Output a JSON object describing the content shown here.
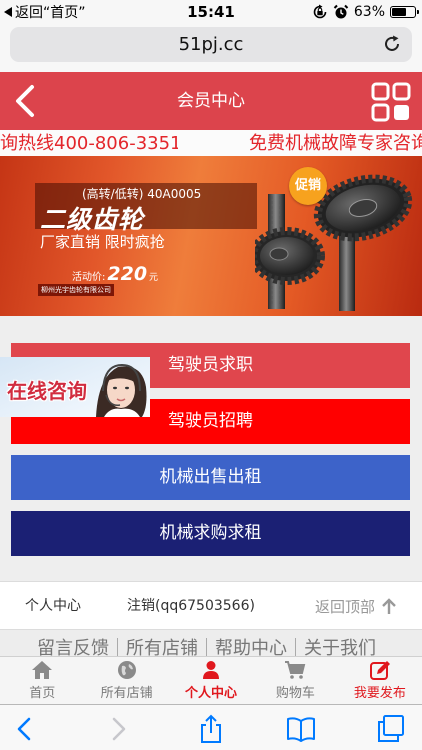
{
  "status_bar": {
    "back_label": "返回“首页”",
    "time": "15:41",
    "battery": "63%",
    "battery_level": 0.63,
    "icons": [
      "orientation-lock-icon",
      "alarm-icon",
      "battery-icon"
    ]
  },
  "browser": {
    "url": "51pj.cc",
    "reload_icon": "reload-icon",
    "toolbar_icons": [
      "back-icon",
      "forward-icon",
      "share-icon",
      "bookmarks-icon",
      "tabs-icon"
    ]
  },
  "header": {
    "title": "会员中心",
    "back_icon": "chevron-left-icon",
    "menu_icon": "grid-icon"
  },
  "marquee": {
    "hotline": "询热线400-806-3351",
    "slogan": "免费机械故障专家咨询"
  },
  "banner": {
    "model": "(高转/低转) 40A0005",
    "headline": "二级齿轮",
    "tagline": "厂家直销 限时疯抢",
    "price_label": "活动价:",
    "price": "220",
    "price_unit": "元",
    "company": "柳州光宇齿轮有限公司",
    "badge": "促销"
  },
  "online_consult": {
    "label": "在线咨询"
  },
  "menu_buttons": [
    {
      "label": "驾驶员求职",
      "color": "#e0464d"
    },
    {
      "label": "驾驶员招聘",
      "color": "#ff0000"
    },
    {
      "label": "机械出售出租",
      "color": "#3d63c9"
    },
    {
      "label": "机械求购求租",
      "color": "#1b2074"
    }
  ],
  "footer": {
    "personal_center": "个人中心",
    "logout": "注销(qq67503566)",
    "back_to_top": "返回顶部",
    "links": [
      "留言反馈",
      "所有店铺",
      "帮助中心",
      "关于我们"
    ]
  },
  "tab_bar": {
    "items": [
      {
        "label": "首页",
        "icon": "home-icon",
        "active": false
      },
      {
        "label": "所有店铺",
        "icon": "globe-icon",
        "active": false
      },
      {
        "label": "个人中心",
        "icon": "user-icon",
        "active": true
      },
      {
        "label": "购物车",
        "icon": "cart-icon",
        "active": false
      },
      {
        "label": "我要发布",
        "icon": "edit-icon",
        "active": false
      }
    ]
  },
  "colors": {
    "header": "#dc444c",
    "marquee_text": "#e3262b",
    "accent": "#e0181e",
    "tab_inactive": "#7a7a7a",
    "ios_blue": "#007aff"
  }
}
